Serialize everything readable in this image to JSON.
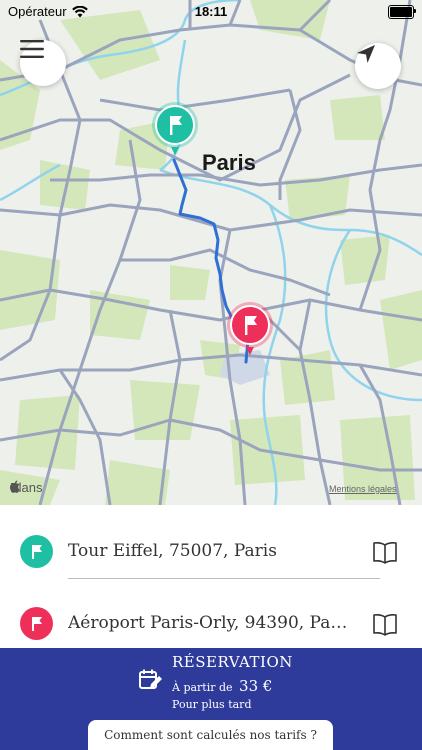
{
  "status_bar": {
    "carrier": "Opérateur",
    "time": "18:11",
    "icons": [
      "wifi-icon",
      "battery-icon"
    ]
  },
  "map": {
    "city_label": "Paris",
    "provider_label": "Plans",
    "legal_link": "Mentions légales",
    "route_color": "#2f6fd6",
    "origin_pin_color": "#1fbfa3",
    "destination_pin_color": "#ee2f5a",
    "icons": [
      "menu-icon",
      "location-arrow-icon",
      "flag-icon"
    ]
  },
  "addresses": {
    "origin": {
      "text": "Tour Eiffel, 75007, Paris",
      "color": "#1fbfa3"
    },
    "destination": {
      "text": "Aéroport Paris-Orly, 94390, Paray...",
      "color": "#ee2f5a"
    }
  },
  "reservation": {
    "title": "RÉSERVATION",
    "price_prefix": "À partir de",
    "price_amount": "33 €",
    "later_label": "Pour plus tard",
    "background_color": "#2f3b9a",
    "tarif_button_label": "Comment sont calculés nos tarifs ?"
  }
}
